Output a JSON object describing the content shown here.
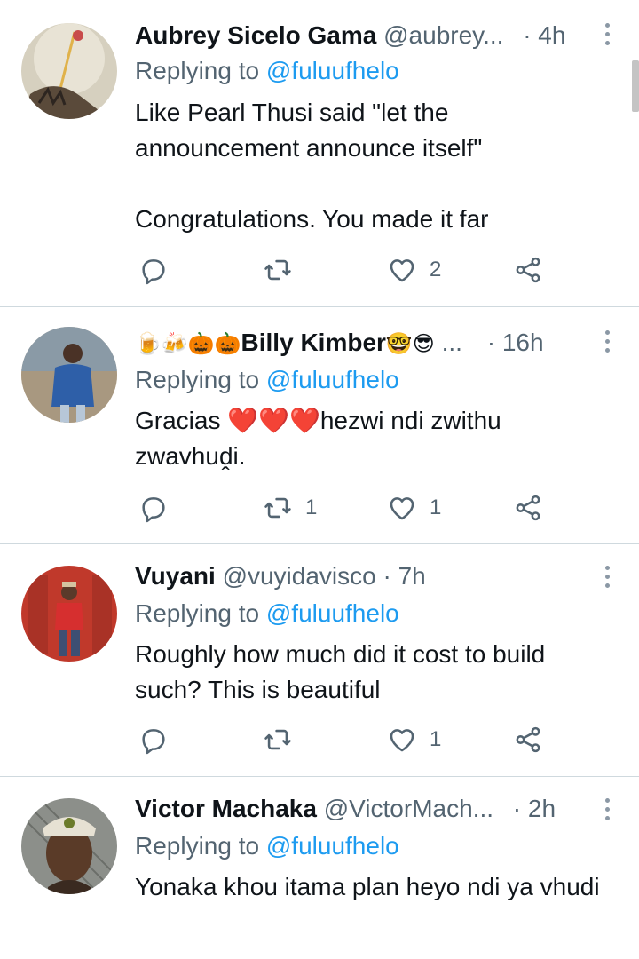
{
  "tweets": [
    {
      "name": "Aubrey Sicelo Gama",
      "handle": "@aubrey...",
      "time": "· 4h",
      "replying_prefix": "Replying to ",
      "replying_to": "@fuluufhelo",
      "text": "Like Pearl Thusi said \"let the announcement announce itself\"\n\nCongratulations. You made it far",
      "retweets": "",
      "likes": "2"
    },
    {
      "name_emoji_prefix": "🍺🍻🎃🎃",
      "name": "Billy Kimber",
      "name_emoji_suffix": "🤓😎",
      "handle": "...",
      "time": "· 16h",
      "replying_prefix": "Replying to ",
      "replying_to": "@fuluufhelo",
      "text_before": "Gracias ",
      "hearts": "❤️❤️❤️",
      "text_after": "hezwi ndi zwithu zwavhuḓi.",
      "retweets": "1",
      "likes": "1"
    },
    {
      "name": "Vuyani",
      "handle": "@vuyidavisco",
      "time": "· 7h",
      "replying_prefix": "Replying to ",
      "replying_to": "@fuluufhelo",
      "text": "Roughly how much did it cost to build such? This is beautiful",
      "retweets": "",
      "likes": "1"
    },
    {
      "name": "Victor Machaka",
      "handle": "@VictorMach...",
      "time": "· 2h",
      "replying_prefix": "Replying to ",
      "replying_to": "@fuluufhelo",
      "text": "Yonaka khou itama plan heyo ndi ya vhudi",
      "retweets": "",
      "likes": ""
    }
  ],
  "icons": {
    "reply": "reply-icon",
    "retweet": "retweet-icon",
    "like": "heart-icon",
    "share": "share-icon",
    "more": "more-vertical-icon"
  },
  "colors": {
    "link": "#1d9bf0",
    "secondary": "#536471",
    "divider": "#cfd9de"
  }
}
